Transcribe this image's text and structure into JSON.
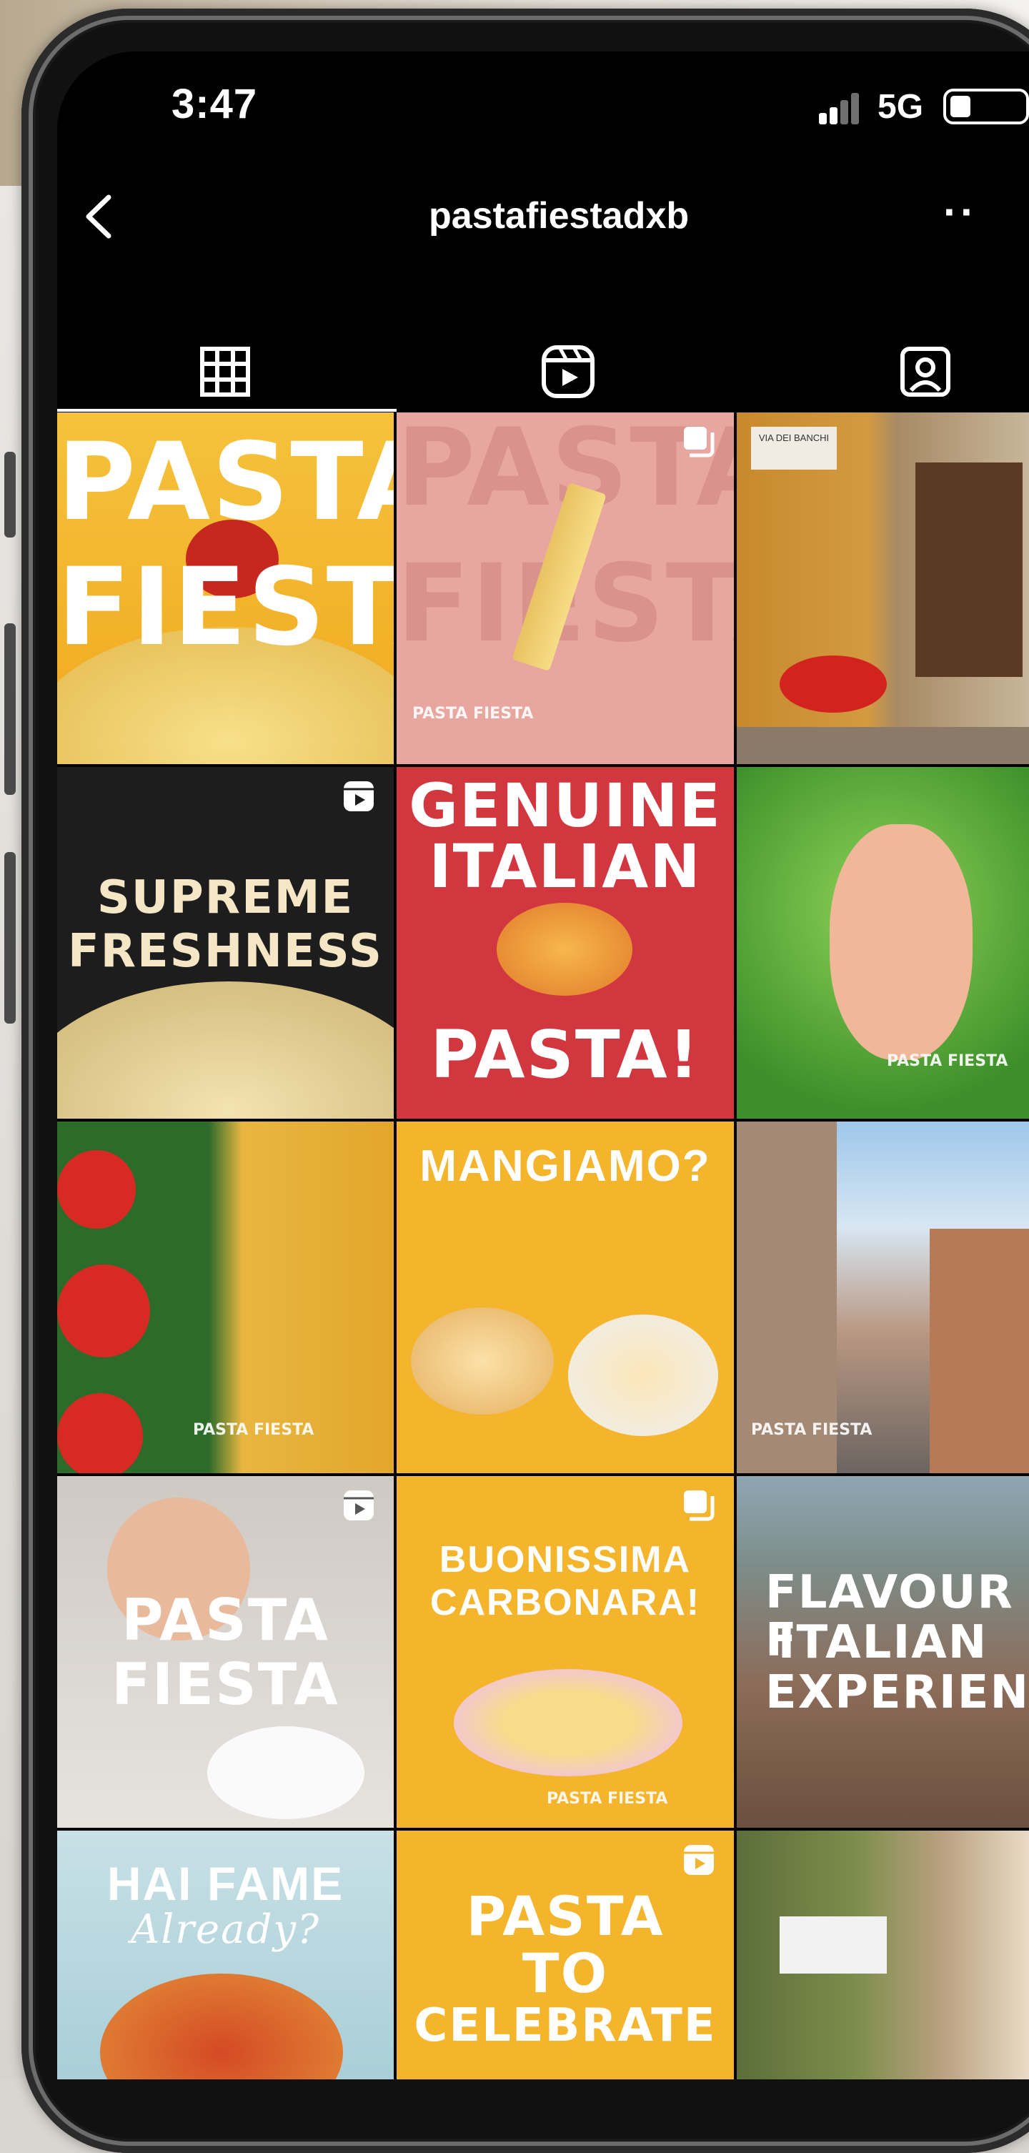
{
  "status_bar": {
    "time": "3:47",
    "network": "5G"
  },
  "header": {
    "username": "pastafiestadxb"
  },
  "tabs": [
    {
      "name": "grid",
      "icon": "grid-icon",
      "active": true
    },
    {
      "name": "reels",
      "icon": "reels-icon",
      "active": false
    },
    {
      "name": "tagged",
      "icon": "tagged-icon",
      "active": false
    }
  ],
  "posts": [
    {
      "lines": [
        "PASTA",
        "FIESTA"
      ],
      "overlay": ""
    },
    {
      "lines": [
        "PASTA",
        "FIESTA"
      ],
      "overlay": "carousel-icon",
      "brand": "PASTA FIESTA"
    },
    {
      "lines": [],
      "overlay": "",
      "sign": "VIA DEI BANCHI"
    },
    {
      "lines": [
        "SUPREME",
        "FRESHNESS"
      ],
      "overlay": "reels-icon"
    },
    {
      "lines": [
        "GENUINE",
        "ITALIAN",
        "PASTA!"
      ],
      "overlay": ""
    },
    {
      "lines": [],
      "overlay": "",
      "brand": "PASTA FIESTA"
    },
    {
      "lines": [],
      "overlay": "",
      "brand": "PASTA FIESTA"
    },
    {
      "lines": [
        "MANGIAMO?"
      ],
      "overlay": ""
    },
    {
      "lines": [],
      "overlay": "",
      "brand": "PASTA FIESTA"
    },
    {
      "lines": [
        "PASTA",
        "FIESTA"
      ],
      "overlay": "reels-icon"
    },
    {
      "lines": [
        "BUONISSIMA",
        "CARBONARA!"
      ],
      "overlay": "carousel-icon",
      "brand": "PASTA FIESTA"
    },
    {
      "lines": [
        "FLAVOUR F",
        "ITALIAN",
        "EXPERIENC"
      ],
      "overlay": ""
    },
    {
      "lines": [
        "HAI FAME",
        "Already?"
      ],
      "overlay": ""
    },
    {
      "lines": [
        "PASTA",
        "TO",
        "CELEBRATE"
      ],
      "overlay": "reels-icon"
    },
    {
      "lines": [],
      "overlay": ""
    }
  ],
  "colors": {
    "yellow": "#f4b52c",
    "pink": "#e7a7a0",
    "red": "#d2373f",
    "green": "#4fa83a",
    "dark": "#1d1d1d"
  }
}
